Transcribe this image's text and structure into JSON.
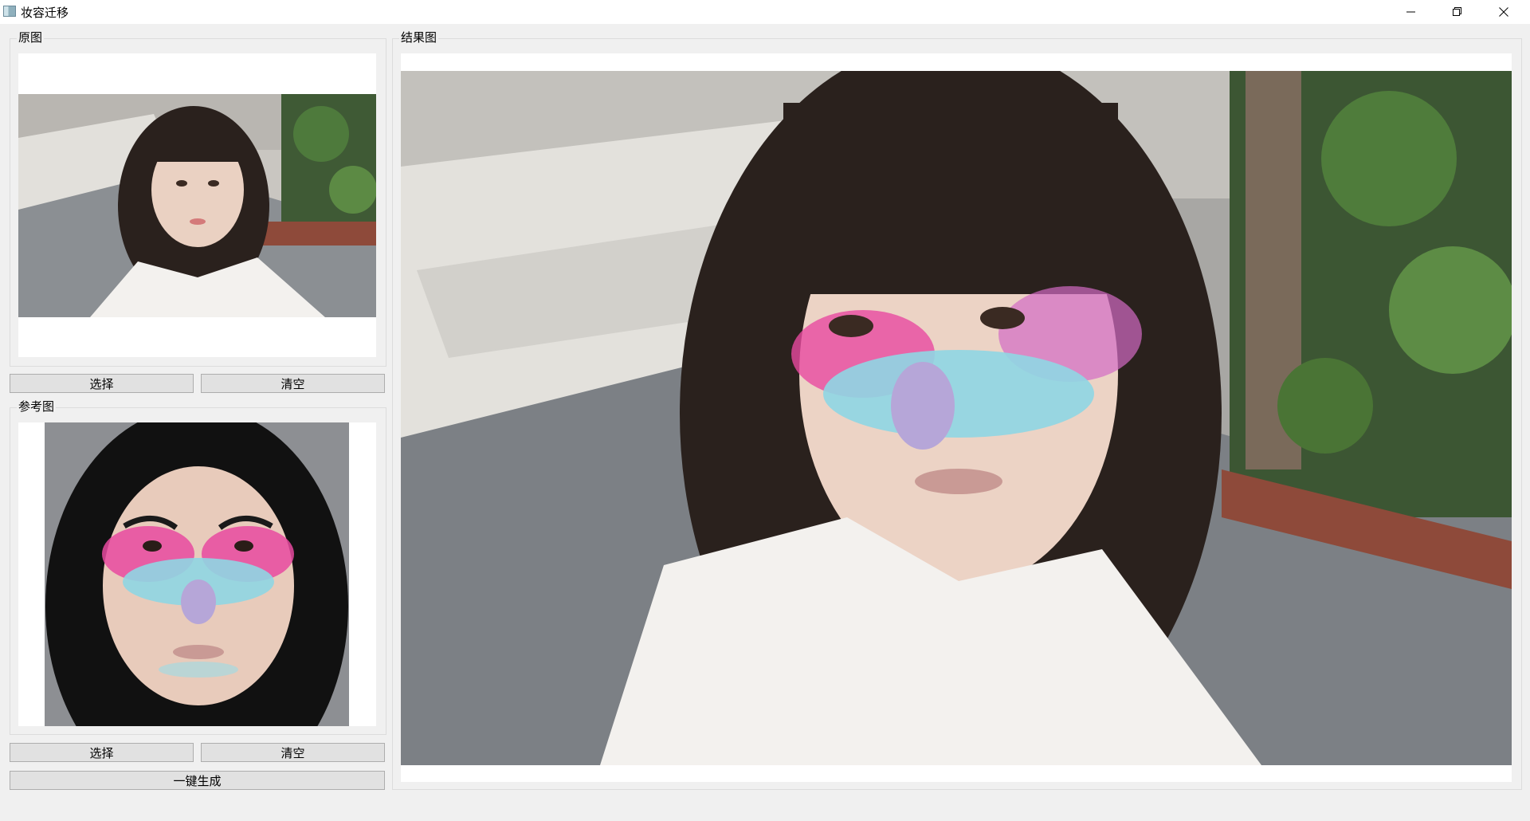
{
  "window": {
    "title": "妆容迁移",
    "icon": "app-icon",
    "controls": [
      "minimize-icon",
      "restore-icon",
      "close-icon"
    ]
  },
  "original": {
    "group_title": "原图",
    "select_label": "选择",
    "clear_label": "清空"
  },
  "reference": {
    "group_title": "参考图",
    "select_label": "选择",
    "clear_label": "清空"
  },
  "generate_label": "一键生成",
  "result": {
    "group_title": "结果图"
  },
  "colors": {
    "window_bg": "#f0f0f0",
    "button_bg": "#e1e1e1",
    "button_border": "#adadad",
    "makeup_pink": "#e84aa0",
    "makeup_blue": "#8fd6e3"
  }
}
